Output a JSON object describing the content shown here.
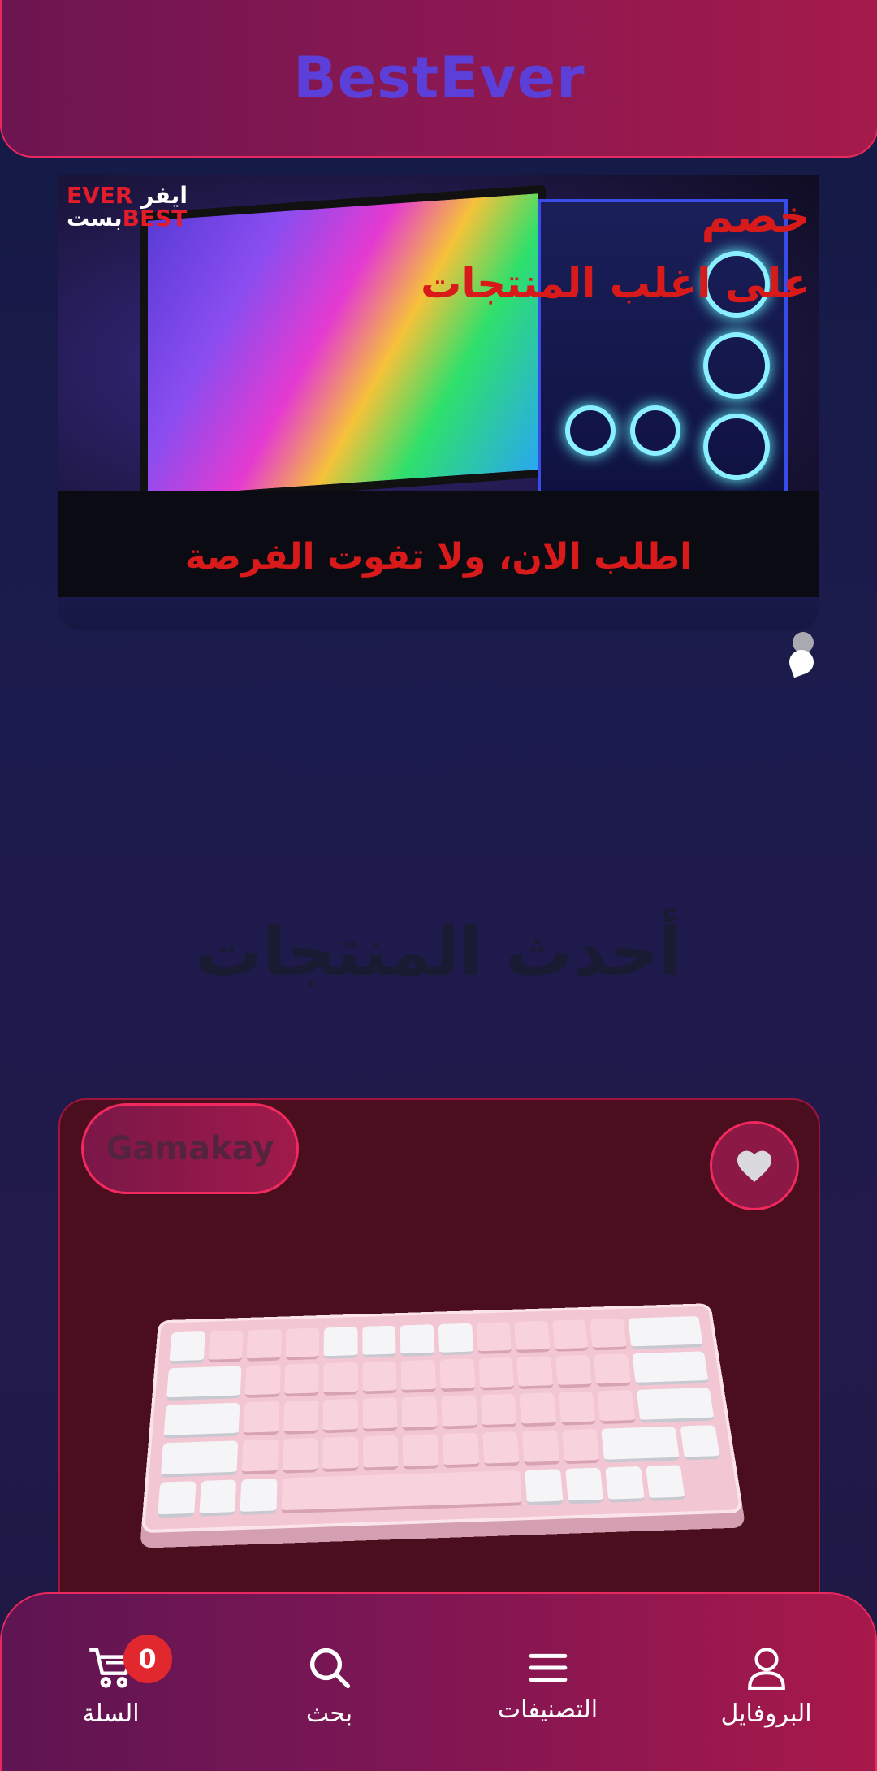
{
  "header": {
    "brand": "BestEver"
  },
  "banner": {
    "logo_line1_red": "EVER",
    "logo_line1_white": "ايفر",
    "logo_line2_white": "بست",
    "logo_line2_red": "BEST",
    "promo_title": "خصم",
    "promo_sub": "على اغلب المنتجات",
    "promo_bottom": "اطلب الان، ولا تفوت الفرصة"
  },
  "section": {
    "title": "أحدث المنتجات"
  },
  "product": {
    "brand": "Gamakay",
    "favorite_icon": "heart-icon"
  },
  "bottom_nav": {
    "items": [
      {
        "label": "البروفايل",
        "icon": "user-icon"
      },
      {
        "label": "التصنيفات",
        "icon": "menu-icon"
      },
      {
        "label": "بحث",
        "icon": "search-icon"
      },
      {
        "label": "السلة",
        "icon": "cart-icon"
      }
    ],
    "cart_count": "0"
  },
  "colors": {
    "accent": "#e8295f",
    "brand_text": "#5b3fd8",
    "promo_red": "#d81a1a"
  }
}
